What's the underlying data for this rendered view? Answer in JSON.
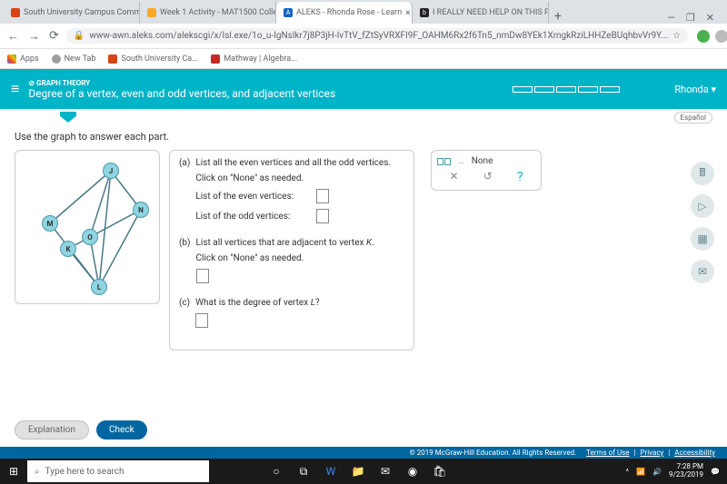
{
  "browser": {
    "tabs": [
      {
        "title": "South University Campus Comm",
        "favicon": "#d84315",
        "active": false
      },
      {
        "title": "Week 1 Activity - MAT1500 Colle",
        "favicon": "#f9a825",
        "active": false
      },
      {
        "title": "ALEKS - Rhonda Rose - Learn",
        "favicon": "#1565c0",
        "active": true
      },
      {
        "title": "I REALLY NEED HELP ON THIS PL",
        "favicon": "#212121",
        "active": false
      }
    ],
    "url": "www-awn.aleks.com/alekscgi/x/Isl.exe/1o_u-IgNslkr7j8P3jH-IvTtV_fZtSyVRXFI9F_OAHM6Rx2f6Tn5_nmDw8YEk1XmgkRziLHHZeBUqhbvVr9Y...",
    "bookmarks": [
      {
        "label": "Apps",
        "favicon": "#4285f4"
      },
      {
        "label": "New Tab",
        "favicon": "#9e9e9e"
      },
      {
        "label": "South University Ca...",
        "favicon": "#d84315"
      },
      {
        "label": "Mathway | Algebra...",
        "favicon": "#c62828"
      }
    ]
  },
  "aleks": {
    "category_icon": "⊘",
    "category": "GRAPH THEORY",
    "topic": "Degree of a vertex, even and odd vertices, and adjacent vertices",
    "user": "Rhonda",
    "espanol": "Español",
    "instruction": "Use the graph to answer each part.",
    "vertices": [
      "J",
      "N",
      "M",
      "O",
      "K",
      "L"
    ],
    "questions": {
      "a": {
        "label": "(a)",
        "text": "List all the even vertices and all the odd vertices.",
        "hint": "Click on \"None\" as needed.",
        "even_label": "List of the even vertices:",
        "odd_label": "List of the odd vertices:"
      },
      "b": {
        "label": "(b)",
        "text": "List all vertices that are adjacent to vertex K.",
        "hint": "Click on \"None\" as needed.",
        "italic_var": "K"
      },
      "c": {
        "label": "(c)",
        "text": "What is the degree of vertex L?",
        "italic_var": "L"
      }
    },
    "helper": {
      "none": "None",
      "x": "✕",
      "undo": "↺",
      "help": "?"
    },
    "buttons": {
      "explanation": "Explanation",
      "check": "Check"
    },
    "footer": {
      "copyright": "© 2019 McGraw-Hill Education. All Rights Reserved.",
      "links": [
        "Terms of Use",
        "Privacy",
        "Accessibility"
      ]
    }
  },
  "taskbar": {
    "search_placeholder": "Type here to search",
    "time": "7:28 PM",
    "date": "9/23/2019"
  }
}
